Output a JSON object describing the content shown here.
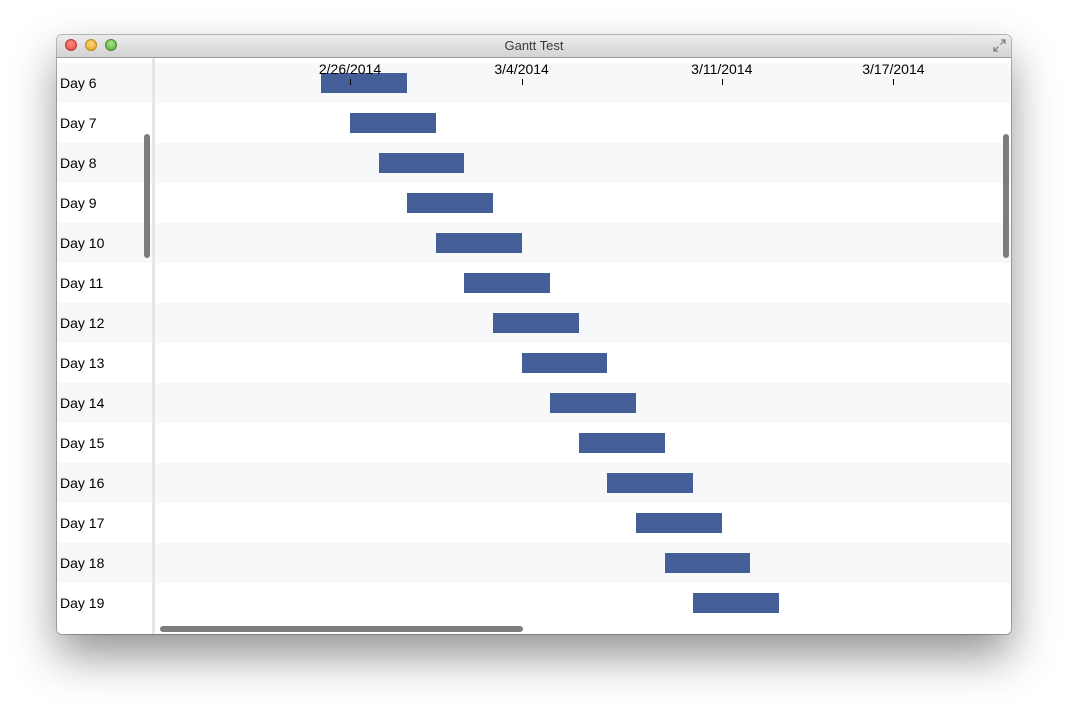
{
  "window": {
    "title": "Gantt Test"
  },
  "colors": {
    "bar": "#445f97",
    "row_alt": "#f7f8fa"
  },
  "timeline": {
    "labels": [
      {
        "date": "2014-02-26",
        "text": "2/26/2014"
      },
      {
        "date": "2014-03-04",
        "text": "3/4/2014"
      },
      {
        "date": "2014-03-11",
        "text": "3/11/2014"
      },
      {
        "date": "2014-03-17",
        "text": "3/17/2014"
      }
    ]
  },
  "tasks": [
    {
      "label": "Day 6",
      "start": "2014-02-25",
      "end": "2014-02-28"
    },
    {
      "label": "Day 7",
      "start": "2014-02-26",
      "end": "2014-03-01"
    },
    {
      "label": "Day 8",
      "start": "2014-02-27",
      "end": "2014-03-02"
    },
    {
      "label": "Day 9",
      "start": "2014-02-28",
      "end": "2014-03-03"
    },
    {
      "label": "Day 10",
      "start": "2014-03-01",
      "end": "2014-03-04"
    },
    {
      "label": "Day 11",
      "start": "2014-03-02",
      "end": "2014-03-05"
    },
    {
      "label": "Day 12",
      "start": "2014-03-03",
      "end": "2014-03-06"
    },
    {
      "label": "Day 13",
      "start": "2014-03-04",
      "end": "2014-03-07"
    },
    {
      "label": "Day 14",
      "start": "2014-03-05",
      "end": "2014-03-08"
    },
    {
      "label": "Day 15",
      "start": "2014-03-06",
      "end": "2014-03-09"
    },
    {
      "label": "Day 16",
      "start": "2014-03-07",
      "end": "2014-03-10"
    },
    {
      "label": "Day 17",
      "start": "2014-03-08",
      "end": "2014-03-11"
    },
    {
      "label": "Day 18",
      "start": "2014-03-09",
      "end": "2014-03-12"
    },
    {
      "label": "Day 19",
      "start": "2014-03-10",
      "end": "2014-03-13"
    }
  ]
}
